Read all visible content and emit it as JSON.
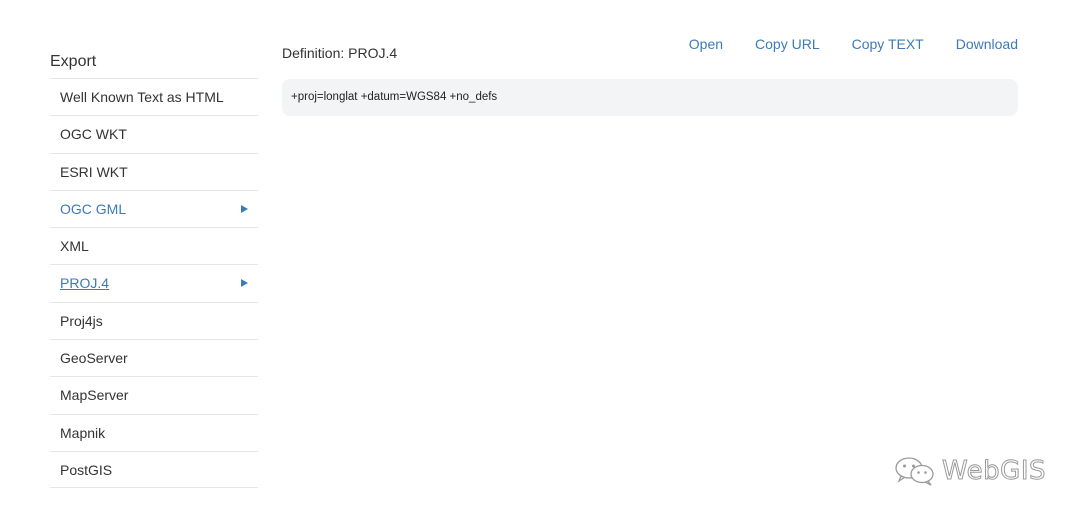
{
  "sidebar": {
    "title": "Export",
    "items": [
      {
        "label": "Well Known Text as HTML"
      },
      {
        "label": "OGC WKT"
      },
      {
        "label": "ESRI WKT"
      },
      {
        "label": "OGC GML"
      },
      {
        "label": "XML"
      },
      {
        "label": "PROJ.4"
      },
      {
        "label": "Proj4js"
      },
      {
        "label": "GeoServer"
      },
      {
        "label": "MapServer"
      },
      {
        "label": "Mapnik"
      },
      {
        "label": "PostGIS"
      }
    ]
  },
  "main": {
    "definition_title": "Definition: PROJ.4",
    "actions": {
      "open": "Open",
      "copy_url": "Copy URL",
      "copy_text": "Copy TEXT",
      "download": "Download"
    },
    "code": "+proj=longlat +datum=WGS84 +no_defs"
  },
  "watermark": {
    "text": "WebGIS",
    "icon": "wechat-icon"
  },
  "colors": {
    "accent": "#3d7ab8",
    "text": "#333333",
    "code_bg": "#f3f4f6",
    "divider": "#e6e6e6"
  }
}
